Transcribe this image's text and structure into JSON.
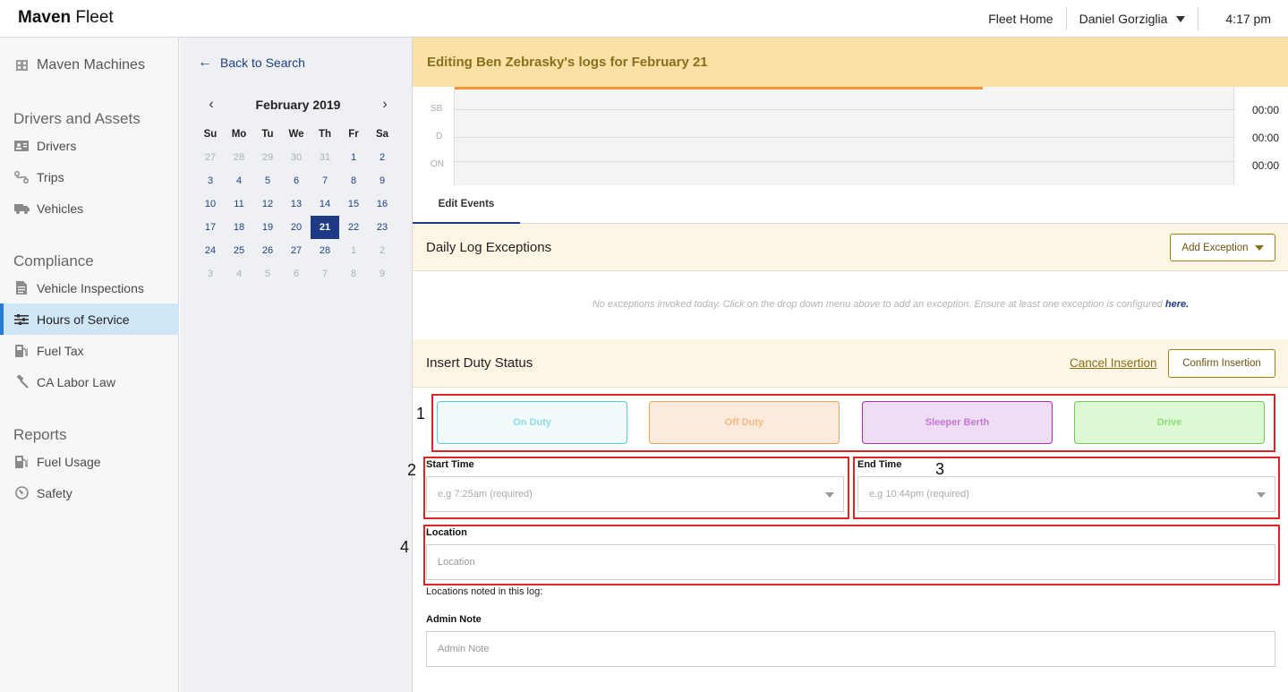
{
  "topbar": {
    "brand_bold": "Maven",
    "brand_rest": " Fleet",
    "fleet_home": "Fleet Home",
    "user": "Daniel Gorziglia",
    "time": "4:17 pm"
  },
  "sidebar": {
    "top_item": {
      "label": "Maven Machines",
      "icon": "building-icon"
    },
    "sections": [
      {
        "heading": "Drivers and Assets"
      },
      {
        "heading": "Compliance"
      },
      {
        "heading": "Reports"
      }
    ],
    "items": [
      {
        "label": "Drivers",
        "icon": "id-card-icon"
      },
      {
        "label": "Trips",
        "icon": "route-icon"
      },
      {
        "label": "Vehicles",
        "icon": "truck-icon"
      },
      {
        "label": "Vehicle Inspections",
        "icon": "document-icon"
      },
      {
        "label": "Hours of Service",
        "icon": "sliders-icon",
        "active": true
      },
      {
        "label": "Fuel Tax",
        "icon": "fuel-pump-icon"
      },
      {
        "label": "CA Labor Law",
        "icon": "gavel-icon"
      },
      {
        "label": "Fuel Usage",
        "icon": "fuel-pump-icon"
      },
      {
        "label": "Safety",
        "icon": "gauge-icon"
      }
    ]
  },
  "calendar": {
    "back_label": "Back to Search",
    "month": "February 2019",
    "prev": "‹",
    "next": "›",
    "dow": [
      "Su",
      "Mo",
      "Tu",
      "We",
      "Th",
      "Fr",
      "Sa"
    ],
    "weeks": [
      [
        "27",
        "28",
        "29",
        "30",
        "31",
        "1",
        "2"
      ],
      [
        "3",
        "4",
        "5",
        "6",
        "7",
        "8",
        "9"
      ],
      [
        "10",
        "11",
        "12",
        "13",
        "14",
        "15",
        "16"
      ],
      [
        "17",
        "18",
        "19",
        "20",
        "21",
        "22",
        "23"
      ],
      [
        "24",
        "25",
        "26",
        "27",
        "28",
        "1",
        "2"
      ],
      [
        "3",
        "4",
        "5",
        "6",
        "7",
        "8",
        "9"
      ]
    ],
    "selected": "21"
  },
  "main": {
    "banner": "Editing Ben Zebrasky's logs for February 21",
    "graph": {
      "rows": [
        {
          "label": "SB",
          "total": "00:00"
        },
        {
          "label": "D",
          "total": "00:00"
        },
        {
          "label": "ON",
          "total": "00:00"
        }
      ]
    },
    "tab": "Edit Events",
    "exceptions": {
      "title": "Daily Log Exceptions",
      "add_button": "Add Exception",
      "message": "No exceptions invoked today. Click on the drop down menu above to add an exception. Ensure at least one exception is configured ",
      "link": "here."
    },
    "insert": {
      "title": "Insert Duty Status",
      "cancel": "Cancel Insertion",
      "confirm": "Confirm Insertion",
      "statuses": [
        {
          "label": "On Duty",
          "bg": "#f1fbfc",
          "border": "#5bc8d8",
          "color": "#8fdbe7"
        },
        {
          "label": "Off Duty",
          "bg": "#fcebdc",
          "border": "#f0a260",
          "color": "#f5b983"
        },
        {
          "label": "Sleeper Berth",
          "bg": "#efdcf5",
          "border": "#a72fb7",
          "color": "#c27ad0"
        },
        {
          "label": "Drive",
          "bg": "#dcf9d4",
          "border": "#6fd055",
          "color": "#8edc7a"
        }
      ],
      "start_label": "Start Time",
      "start_placeholder": "e.g 7:25am (required)",
      "end_label": "End Time",
      "end_placeholder": "e.g 10:44pm (required)",
      "location_label": "Location",
      "location_placeholder": "Location",
      "locations_note": "Locations noted in this log:",
      "admin_label": "Admin Note",
      "admin_placeholder": "Admin Note"
    },
    "annotations": [
      "1",
      "2",
      "3",
      "4"
    ]
  }
}
